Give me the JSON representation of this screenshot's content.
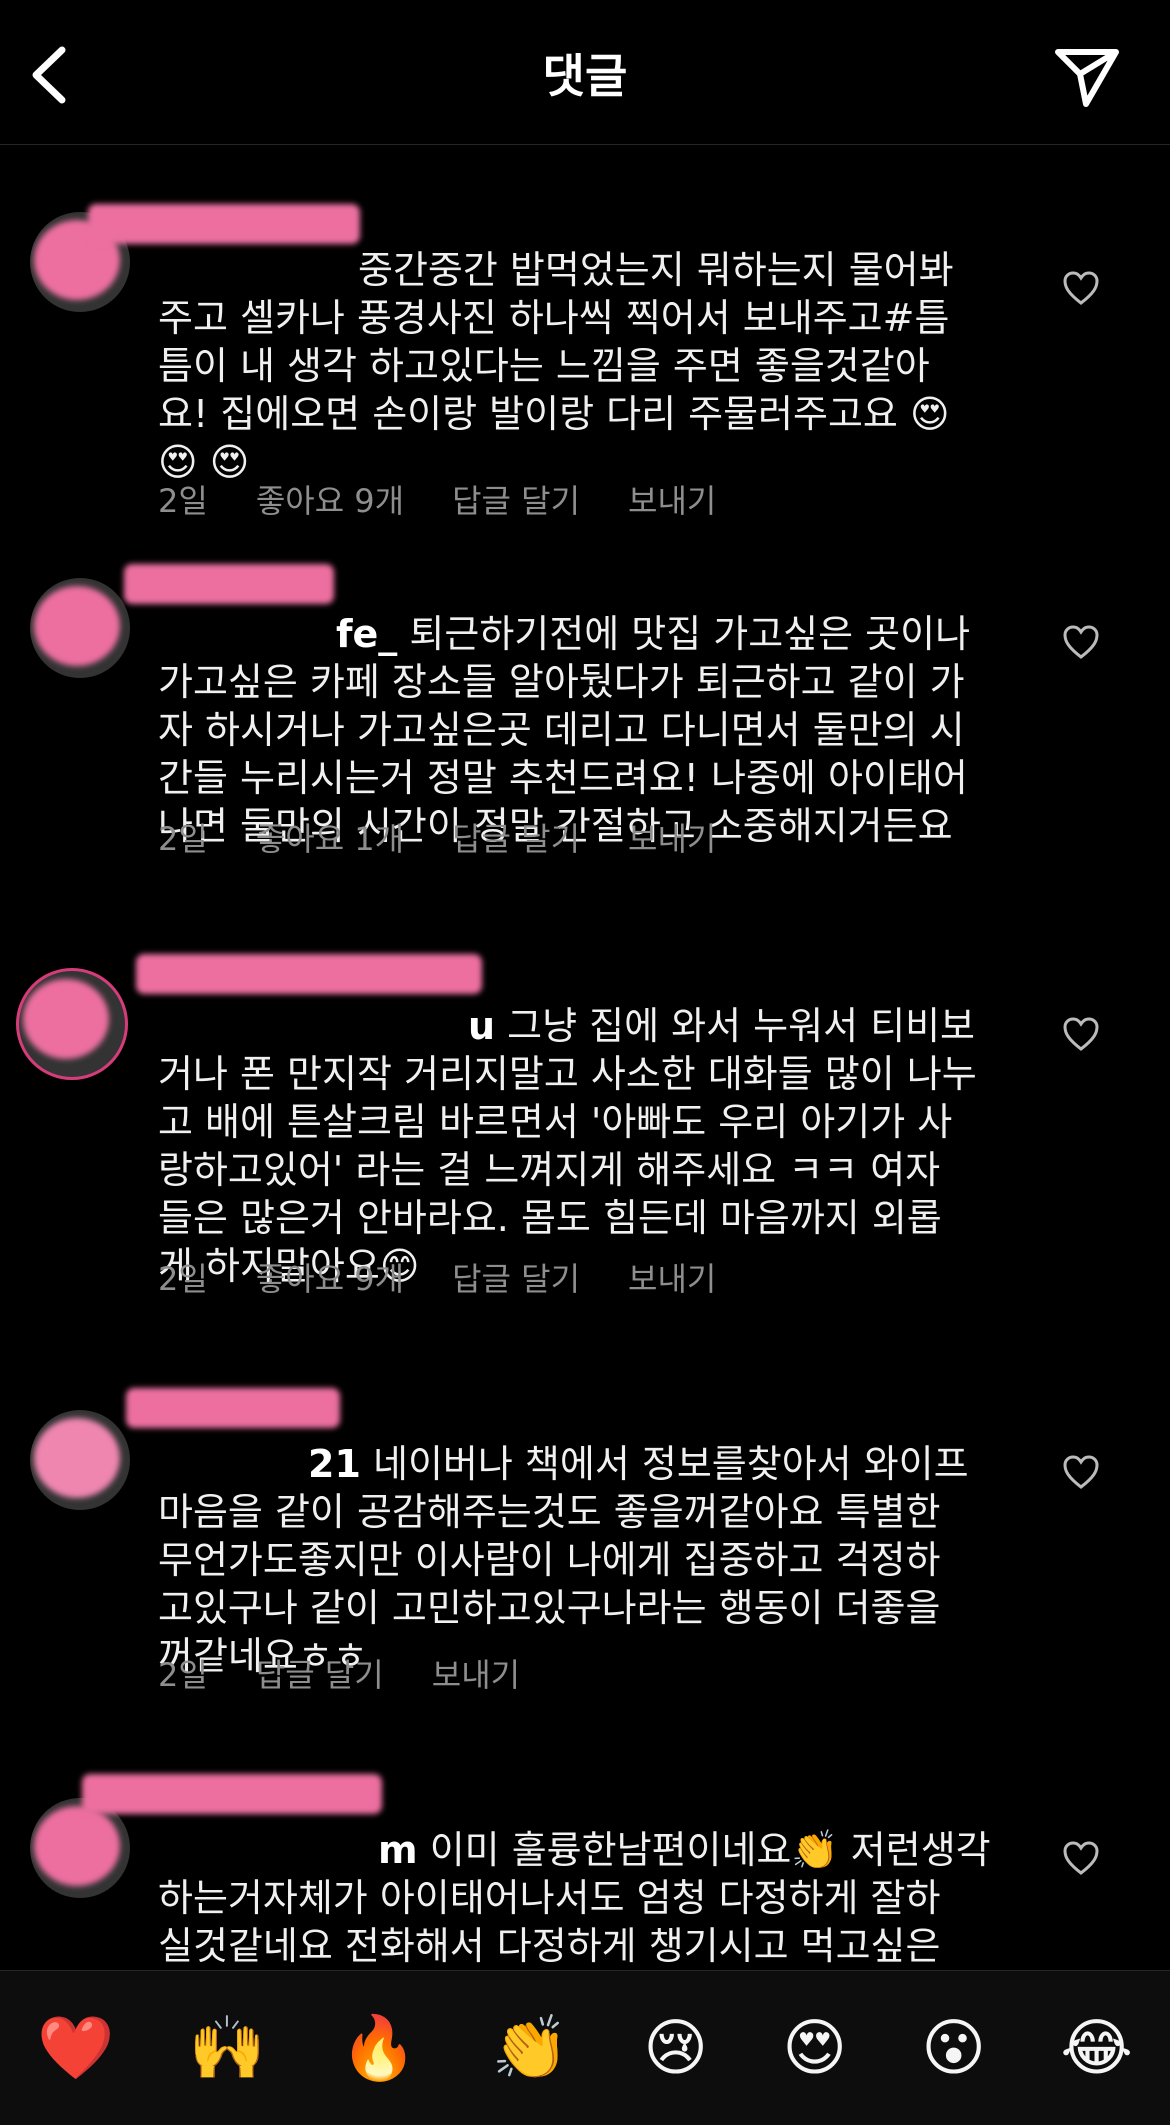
{
  "header": {
    "title": "댓글",
    "back_icon": "chevron-left-icon",
    "share_icon": "paper-plane-icon"
  },
  "comments": [
    {
      "username": "",
      "text": "중간중간 밥먹었는지 뭐하는지 물어봐\n주고 셀카나 풍경사진 하나씩 찍어서 보내주고#틈\n틈이 내 생각 하고있다는 느낌을 주면 좋을것같아\n요! 집에오면 손이랑 발이랑 다리 주물러주고요 😍\n😍 😍",
      "time": "2일",
      "likes": "좋아요 9개",
      "reply": "답글 달기",
      "send": "보내기"
    },
    {
      "username": "fe_",
      "text": "퇴근하기전에 맛집 가고싶은 곳이나\n가고싶은 카페 장소들 알아뒀다가 퇴근하고 같이 가\n자 하시거나 가고싶은곳 데리고 다니면서 둘만의 시\n간들 누리시는거 정말 추천드려요! 나중에 아이태어\n나면 둘만의 시간이 정말 간절하고 소중해지거든요",
      "time": "2일",
      "likes": "좋아요 1개",
      "reply": "답글 달기",
      "send": "보내기"
    },
    {
      "username": "u",
      "text": "그냥 집에 와서 누워서 티비보\n거나 폰 만지작 거리지말고 사소한 대화들 많이 나누\n고 배에 튼살크림 바르면서 '아빠도 우리 아기가 사\n랑하고있어' 라는 걸 느껴지게 해주세요 ㅋㅋ 여자\n들은 많은거 안바라요. 몸도 힘든데 마음까지 외롭\n게 하지말아요😊",
      "time": "2일",
      "likes": "좋아요 9개",
      "reply": "답글 달기",
      "send": "보내기"
    },
    {
      "username": "21",
      "text": "네이버나 책에서 정보를찾아서 와이프\n마음을 같이 공감해주는것도 좋을꺼같아요  특별한\n무언가도좋지만 이사람이 나에게 집중하고 걱정하\n고있구나 같이 고민하고있구나라는 행동이 더좋을\n꺼같네요ㅎㅎ",
      "time": "2일",
      "likes": "",
      "reply": "답글 달기",
      "send": "보내기"
    },
    {
      "username": "m",
      "text": "이미 훌륭한남편이네요👏 저런생각\n하는거자체가 아이태어나서도 엄청 다정하게 잘하\n실것같네요 전화해서 다정하게 챙기시고 먹고싶은\n거 물어봐서 사가지고 퇴근하시면 기분 풀리죠 항상",
      "time": "",
      "likes": "",
      "reply": "",
      "send": ""
    }
  ],
  "reactions": [
    "❤️",
    "🙌",
    "🔥",
    "👏",
    "😢",
    "😍",
    "😮",
    "😂"
  ],
  "colors": {
    "background": "#000000",
    "muted": "#8e8e8e",
    "mask": "#ec6fa0"
  }
}
